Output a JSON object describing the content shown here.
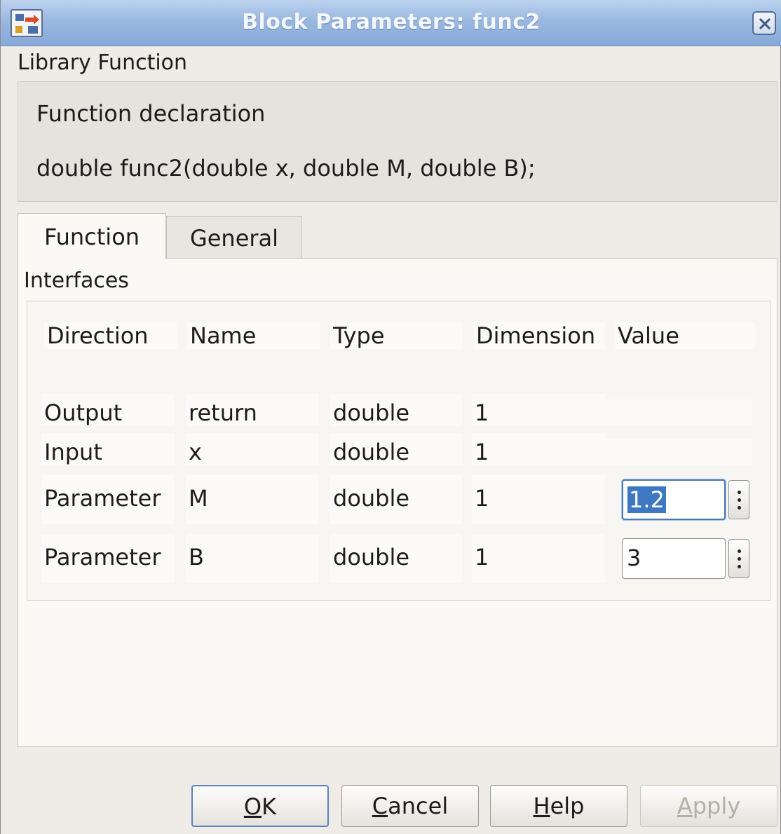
{
  "window": {
    "title": "Block Parameters: func2"
  },
  "block": {
    "type_label": "Library Function",
    "description_title": "Function declaration",
    "declaration": "double func2(double x, double M, double B);"
  },
  "tabs": [
    {
      "label": "Function",
      "active": true
    },
    {
      "label": "General",
      "active": false
    }
  ],
  "interfaces": {
    "group_label": "Interfaces",
    "columns": [
      "Direction",
      "Name",
      "Type",
      "Dimension",
      "Value"
    ],
    "rows": [
      {
        "direction": "Output",
        "name": "return",
        "type": "double",
        "dimension": "1",
        "value": null
      },
      {
        "direction": "Input",
        "name": "x",
        "type": "double",
        "dimension": "1",
        "value": null
      },
      {
        "direction": "Parameter",
        "name": "M",
        "type": "double",
        "dimension": "1",
        "value": "1.2"
      },
      {
        "direction": "Parameter",
        "name": "B",
        "type": "double",
        "dimension": "1",
        "value": "3"
      }
    ]
  },
  "buttons": {
    "ok": {
      "mnemonic": "O",
      "rest": "K"
    },
    "cancel": {
      "mnemonic": "C",
      "rest": "ancel"
    },
    "help": {
      "mnemonic": "H",
      "rest": "elp"
    },
    "apply": {
      "mnemonic": "A",
      "rest": "pply",
      "enabled": false
    }
  },
  "colors": {
    "titlebar": "#9ab8e0",
    "selection": "#3e77c2",
    "dialog_bg": "#efebe7"
  }
}
